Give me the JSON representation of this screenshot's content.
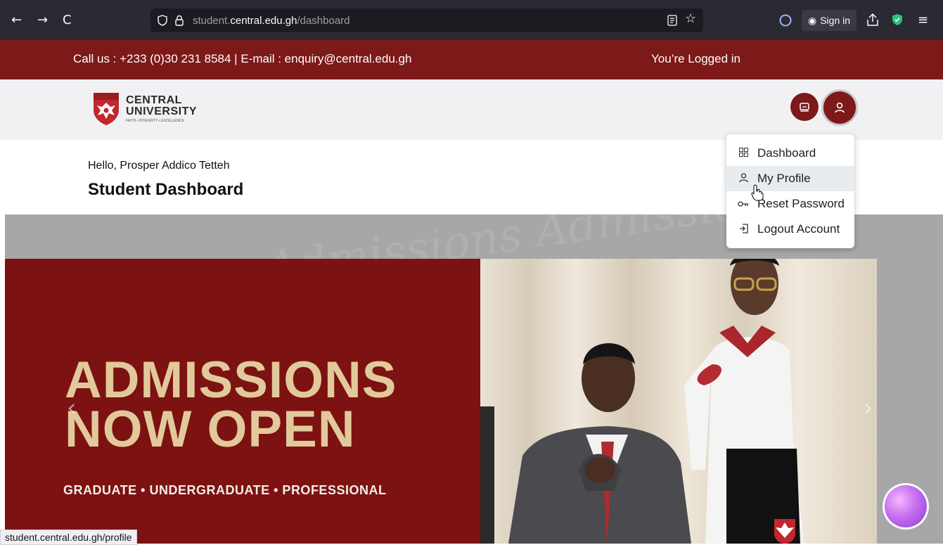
{
  "browser": {
    "back_icon": "←",
    "forward_icon": "→",
    "reload_icon": "C",
    "url_prefix": "student.",
    "url_domain": "central.edu.gh",
    "url_path": "/dashboard",
    "signin_label": "Sign in"
  },
  "topbar": {
    "contact": "Call us : +233 (0)30 231 8584 | E-mail : enquiry@central.edu.gh",
    "logged": "You’re Logged in"
  },
  "logo": {
    "line1": "CENTRAL",
    "line2": "UNIVERSITY",
    "tagline": "FAITH • INTEGRITY • EXCELLENCE"
  },
  "page": {
    "greeting": "Hello, Prosper Addico Tetteh",
    "title": "Student Dashboard"
  },
  "banner": {
    "line1": "ADMISSIONS",
    "line2": "NOW OPEN",
    "subline": "GRADUATE • UNDERGRADUATE • PROFESSIONAL",
    "watermark": "Admissions Admissions Admissions Admissions"
  },
  "dropdown": {
    "items": [
      {
        "label": "Dashboard",
        "icon": "grid-icon"
      },
      {
        "label": "My Profile",
        "icon": "user-icon"
      },
      {
        "label": "Reset Password",
        "icon": "key-icon"
      },
      {
        "label": "Logout Account",
        "icon": "logout-icon"
      }
    ]
  },
  "status": {
    "link": "student.central.edu.gh/profile"
  },
  "colors": {
    "brand": "#7d1a19",
    "banner_text": "#e2c99b"
  }
}
